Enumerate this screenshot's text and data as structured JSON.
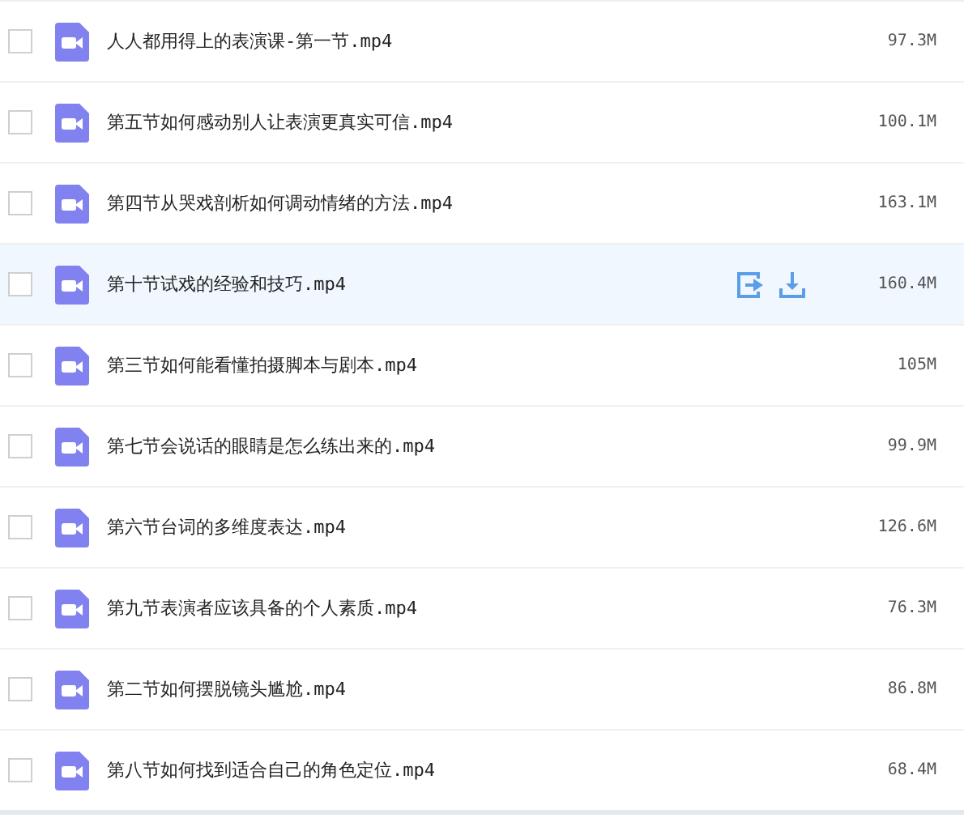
{
  "files": [
    {
      "name": "人人都用得上的表演课-第一节.mp4",
      "size": "97.3M",
      "checked": false,
      "hovered": false
    },
    {
      "name": "第五节如何感动别人让表演更真实可信.mp4",
      "size": "100.1M",
      "checked": false,
      "hovered": false
    },
    {
      "name": "第四节从哭戏剖析如何调动情绪的方法.mp4",
      "size": "163.1M",
      "checked": false,
      "hovered": false
    },
    {
      "name": "第十节试戏的经验和技巧.mp4",
      "size": "160.4M",
      "checked": false,
      "hovered": true
    },
    {
      "name": "第三节如何能看懂拍摄脚本与剧本.mp4",
      "size": "105M",
      "checked": false,
      "hovered": false
    },
    {
      "name": "第七节会说话的眼睛是怎么练出来的.mp4",
      "size": "99.9M",
      "checked": false,
      "hovered": false
    },
    {
      "name": "第六节台词的多维度表达.mp4",
      "size": "126.6M",
      "checked": false,
      "hovered": false
    },
    {
      "name": "第九节表演者应该具备的个人素质.mp4",
      "size": "76.3M",
      "checked": false,
      "hovered": false
    },
    {
      "name": "第二节如何摆脱镜头尴尬.mp4",
      "size": "86.8M",
      "checked": false,
      "hovered": false
    },
    {
      "name": "第八节如何找到适合自己的角色定位.mp4",
      "size": "68.4M",
      "checked": false,
      "hovered": false
    }
  ]
}
